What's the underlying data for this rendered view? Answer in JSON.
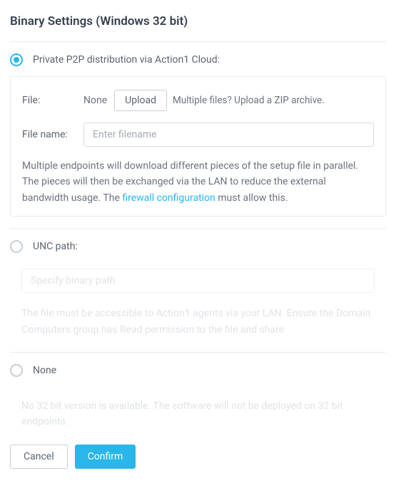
{
  "title": "Binary Settings (Windows 32 bit)",
  "option_p2p": {
    "label": "Private P2P distribution via Action1 Cloud:",
    "file_label": "File:",
    "file_value": "None",
    "upload_btn": "Upload",
    "upload_hint": "Multiple files? Upload a ZIP archive.",
    "filename_label": "File name:",
    "filename_placeholder": "Enter filename",
    "info_pre": "Multiple endpoints will download different pieces of the setup file in parallel. The pieces will then be exchanged via the LAN to reduce the external bandwidth usage.  The ",
    "info_link": "firewall configuration",
    "info_post": "  must allow this."
  },
  "option_unc": {
    "label": "UNC path:",
    "path_placeholder": "Specify binary path",
    "info": "The file must be accessible to Action1 agents via your LAN. Ensure the Domain Computers group has Read permission to the file and share"
  },
  "option_none": {
    "label": "None",
    "info": "No 32 bit version is available. The software will not be deployed on 32 bit endpoints."
  },
  "actions": {
    "cancel": "Cancel",
    "confirm": "Confirm"
  }
}
